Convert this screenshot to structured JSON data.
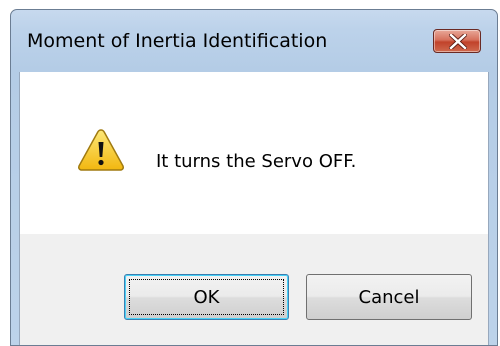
{
  "dialog": {
    "title": "Moment of Inertia Identification",
    "message": "It turns the Servo OFF.",
    "icon": "warning-icon",
    "close_icon": "close-icon"
  },
  "buttons": {
    "ok_label": "OK",
    "cancel_label": "Cancel"
  },
  "colors": {
    "title_bar": "#bcd2ea",
    "close_button": "#c1432b",
    "client_background": "#f0f0f0",
    "content_background": "#ffffff",
    "warning_fill": "#f6c51e"
  }
}
